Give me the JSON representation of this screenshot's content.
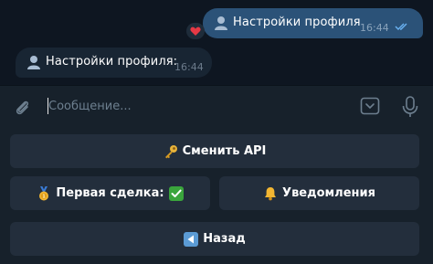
{
  "messages": [
    {
      "direction": "outgoing",
      "icon": "user-icon",
      "text": "Настройки профиля",
      "time": "16:44",
      "status": "read",
      "reaction": "heart"
    },
    {
      "direction": "incoming",
      "icon": "user-icon",
      "text": "Настройки профиля:",
      "time": "16:44"
    }
  ],
  "composer": {
    "placeholder": "Сообщение...",
    "value": ""
  },
  "keyboard": {
    "row1": {
      "label": "Сменить API",
      "icon": "key-icon"
    },
    "row2": [
      {
        "label": "Первая сделка:",
        "icon": "medal-icon",
        "suffix_icon": "check-mark-icon"
      },
      {
        "label": "Уведомления",
        "icon": "bell-icon"
      }
    ],
    "row3": {
      "label": "Назад",
      "icon": "back-arrow-icon"
    }
  },
  "colors": {
    "background": "#0e1621",
    "outgoing_bubble": "#2b5278",
    "incoming_bubble": "#182533",
    "panel": "#17212b",
    "button": "#232e3c",
    "read_checks": "#6ab3f3"
  }
}
